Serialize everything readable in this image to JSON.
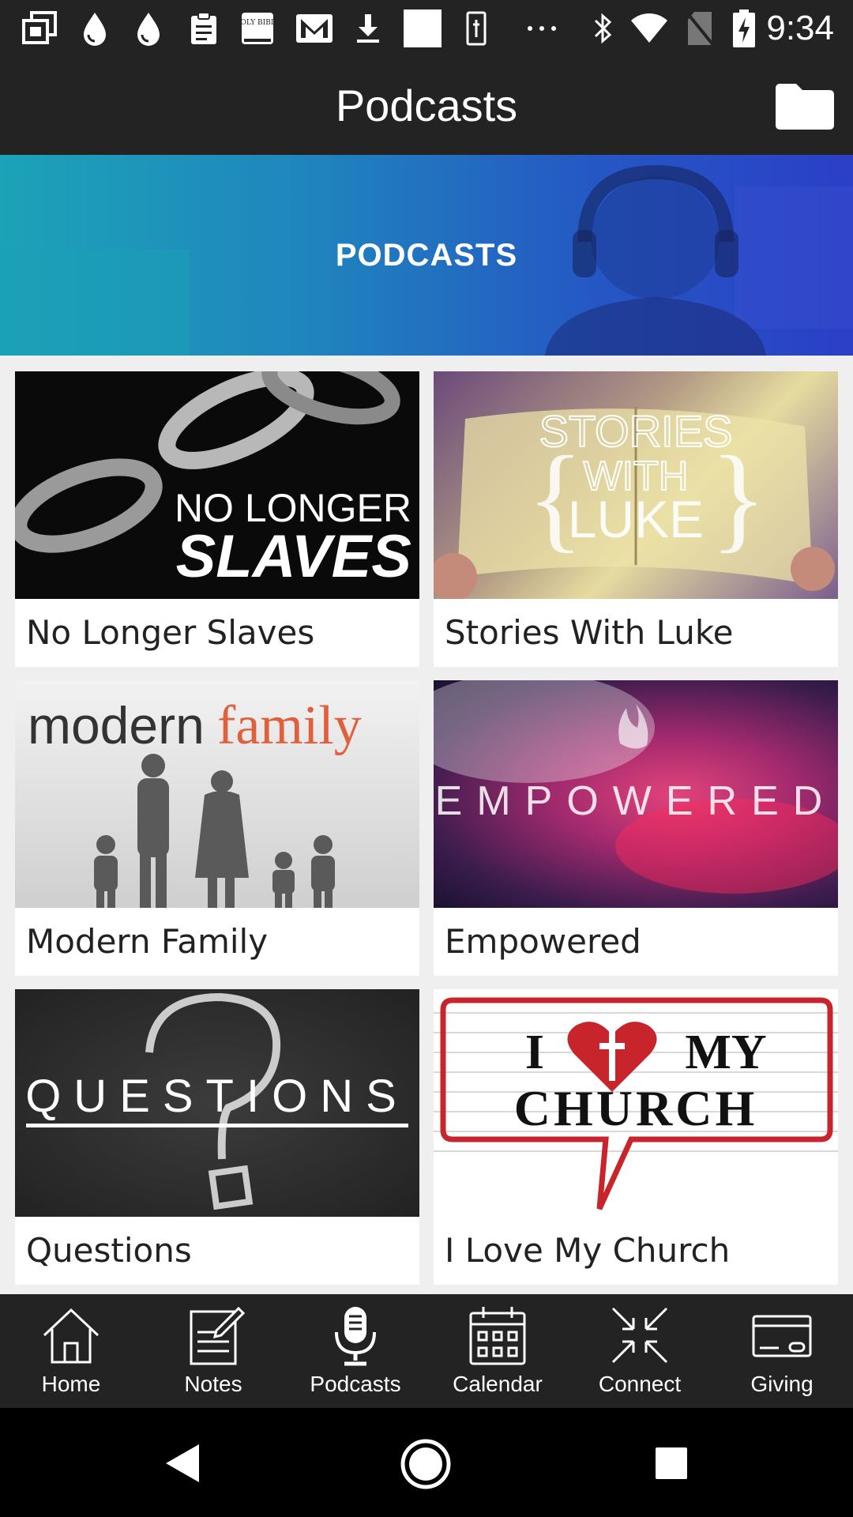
{
  "status_bar": {
    "time": "9:34",
    "left_icons": [
      "gallery-icon",
      "drop-icon",
      "drop-icon",
      "clipboard-icon",
      "holy-bible-icon",
      "gmail-icon",
      "download-icon",
      "square-icon",
      "phone-icon",
      "more-icon"
    ],
    "right_icons": [
      "bluetooth-icon",
      "wifi-icon",
      "no-sim-icon",
      "battery-charging-icon"
    ],
    "bible_icon_text": "HOLY BIBLE"
  },
  "app_bar": {
    "title": "Podcasts",
    "folder_icon": "folder-icon"
  },
  "banner": {
    "title": "PODCASTS"
  },
  "podcasts": [
    {
      "label": "No Longer Slaves",
      "art_line1": "NO LONGER",
      "art_line2": "SLAVES"
    },
    {
      "label": "Stories With Luke",
      "art_line1": "STORIES",
      "art_line2": "WITH",
      "art_line3": "LUKE"
    },
    {
      "label": "Modern Family",
      "art_line1": "modern",
      "art_line2": "family"
    },
    {
      "label": "Empowered",
      "art_line1": "EMPOWERED"
    },
    {
      "label": "Questions",
      "art_line1": "QUESTIONS"
    },
    {
      "label": "I Love My Church",
      "art_line1": "I",
      "art_line2": "MY",
      "art_line3": "CHURCH"
    }
  ],
  "bottom_nav": [
    {
      "label": "Home",
      "icon": "home-icon"
    },
    {
      "label": "Notes",
      "icon": "notes-icon"
    },
    {
      "label": "Podcasts",
      "icon": "microphone-icon"
    },
    {
      "label": "Calendar",
      "icon": "calendar-icon"
    },
    {
      "label": "Connect",
      "icon": "connect-icon"
    },
    {
      "label": "Giving",
      "icon": "credit-card-icon"
    }
  ],
  "system_nav": [
    "back-icon",
    "home-circle-icon",
    "recents-icon"
  ],
  "colors": {
    "bar_bg": "#232323",
    "page_bg": "#efefef",
    "banner_start": "#1ca3b8",
    "banner_end": "#2b3fc7"
  }
}
